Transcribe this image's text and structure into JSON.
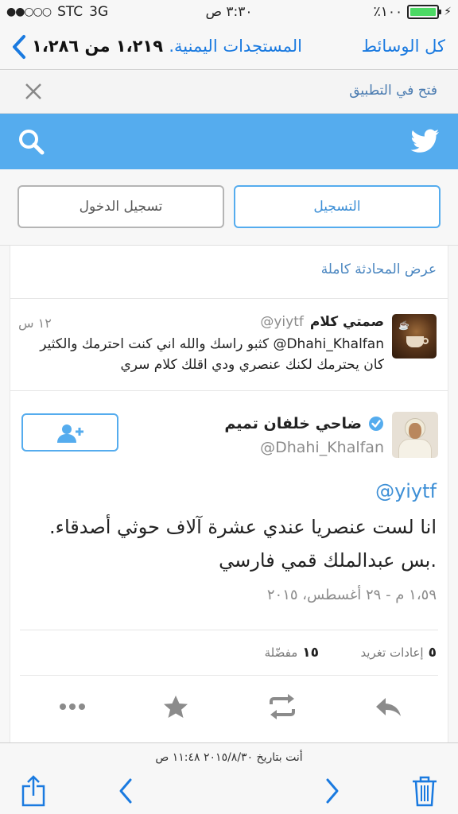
{
  "status_bar": {
    "signal_dots": "●●○○○",
    "carrier": "STC",
    "network": "3G",
    "time": "٣:٣٠ ص",
    "battery_percent": "٪١٠٠",
    "battery_level": 1.0
  },
  "nav": {
    "back_label": "المستجدات اليمنية.",
    "position_text": "١،٢١٩ من ١،٢٨٦",
    "right_link": "كل الوسائط"
  },
  "open_in_app": {
    "label": "فتح في التطبيق"
  },
  "auth": {
    "signup_label": "التسجيل",
    "login_label": "تسجيل الدخول"
  },
  "conversation": {
    "view_full": "عرض المحادثة كاملة",
    "reply": {
      "name": "صمتي كلام",
      "handle": "@yiytf",
      "time": "١٢ س",
      "mention": "@Dhahi_Khalfan",
      "text": "كثبو راسك والله اني كنت احترمك والكثير كان يحترمك لكنك عنصري  ودي اقلك كلام سري"
    },
    "tweet": {
      "name": "ضاحي خلفان تميم",
      "handle": "@Dhahi_Khalfan",
      "mention": "@yiytf",
      "text": "انا لست عنصريا عندي عشرة آلاف حوثي أصدقاء. .بس عبدالملك  قمي فارسي",
      "date": "١،٥٩ م - ٢٩ أغسطس، ٢٠١٥",
      "retweets_count": "٥",
      "retweets_label": "إعادات تغريد",
      "favorites_count": "١٥",
      "favorites_label": "مفضّلة"
    }
  },
  "toolbar": {
    "timestamp": "أنت بتاريخ ٢٠١٥/٨/٣٠ ١١:٤٨ ص"
  },
  "colors": {
    "twitter_blue": "#55acee",
    "ios_blue": "#1a7ae0",
    "battery_green": "#4cd964"
  }
}
